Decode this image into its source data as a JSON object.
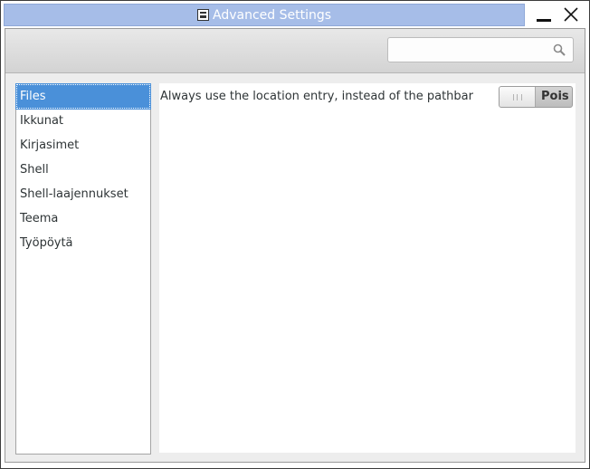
{
  "window": {
    "title": "Advanced Settings",
    "app_icon": "tweak-tool-icon",
    "minimize_icon": "minimize-icon",
    "close_icon": "close-icon"
  },
  "header": {
    "search": {
      "value": "",
      "placeholder": "",
      "icon": "search-icon"
    }
  },
  "sidebar": {
    "selected": "Files",
    "items": [
      {
        "label": "Files"
      },
      {
        "label": "Ikkunat"
      },
      {
        "label": "Kirjasimet"
      },
      {
        "label": "Shell"
      },
      {
        "label": "Shell-laajennukset"
      },
      {
        "label": "Teema"
      },
      {
        "label": "Työpöytä"
      }
    ]
  },
  "content": {
    "settings": [
      {
        "label": "Always use the location entry, instead of the pathbar",
        "state": "Pois",
        "enabled": false
      }
    ]
  },
  "colors": {
    "titlebar": "#a6bde8",
    "selection": "#4a90d9"
  }
}
